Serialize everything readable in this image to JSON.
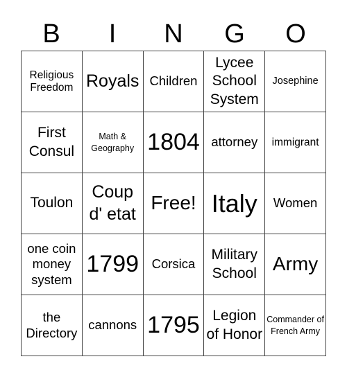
{
  "title_letters": [
    "B",
    "I",
    "N",
    "G",
    "O"
  ],
  "cells": [
    "Religious Freedom",
    "Royals",
    "Children",
    "Lycee School System",
    "Josephine",
    "First Consul",
    "Math & Geography",
    "1804",
    "attorney",
    "immigrant",
    "Toulon",
    "Coup d' etat",
    "Free!",
    "Italy",
    "Women",
    "one coin money system",
    "1799",
    "Corsica",
    "Military School",
    "Army",
    "the Directory",
    "cannons",
    "1795",
    "Legion of Honor",
    "Commander of French Army"
  ]
}
